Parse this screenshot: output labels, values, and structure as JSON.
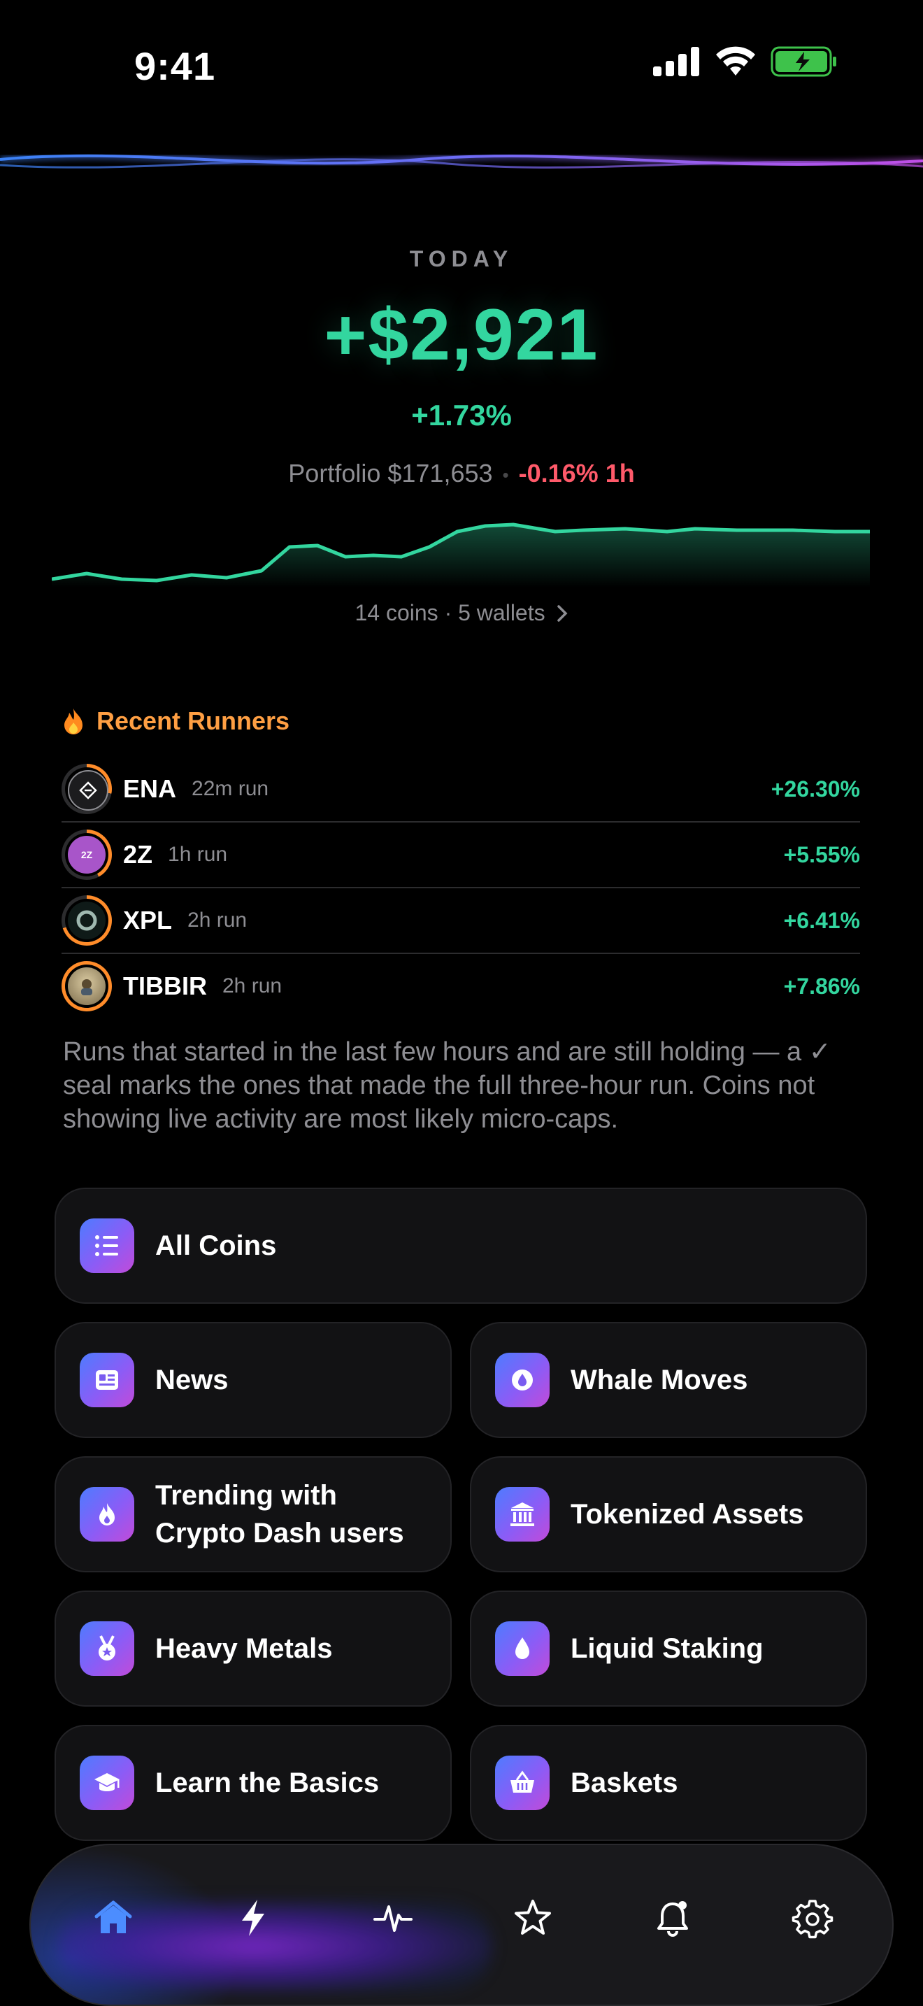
{
  "status": {
    "time": "9:41"
  },
  "today": {
    "label": "TODAY",
    "amount": "+$2,921",
    "percent": "+1.73%",
    "portfolio_label": "Portfolio $171,653",
    "change_1h": "-0.16% 1h",
    "coins_wallets": "14 coins · 5 wallets"
  },
  "colors": {
    "positive": "#33d69f",
    "negative": "#ff5a6a",
    "accent": "#ff9f43"
  },
  "runners": {
    "title": "Recent Runners",
    "items": [
      {
        "symbol": "ENA",
        "age": "22m run",
        "change": "+26.30%"
      },
      {
        "symbol": "2Z",
        "age": "1h run",
        "change": "+5.55%"
      },
      {
        "symbol": "XPL",
        "age": "2h run",
        "change": "+6.41%"
      },
      {
        "symbol": "TIBBIR",
        "age": "2h run",
        "change": "+7.86%"
      }
    ],
    "note": "Runs that started in the last few hours and are still holding — a ✓ seal marks the ones that made the full three-hour run. Coins not showing live activity are most likely micro-caps."
  },
  "cards": {
    "all_coins": "All Coins",
    "news": "News",
    "whale_moves": "Whale Moves",
    "trending": "Trending with Crypto Dash users",
    "tokenized_assets": "Tokenized Assets",
    "heavy_metals": "Heavy Metals",
    "liquid_staking": "Liquid Staking",
    "learn_basics": "Learn the Basics",
    "baskets": "Baskets"
  },
  "tabbar": {
    "icons": [
      "home-icon",
      "bolt-icon",
      "pulse-icon",
      "star-icon",
      "bell-icon",
      "gear-icon"
    ],
    "selected": "home"
  }
}
